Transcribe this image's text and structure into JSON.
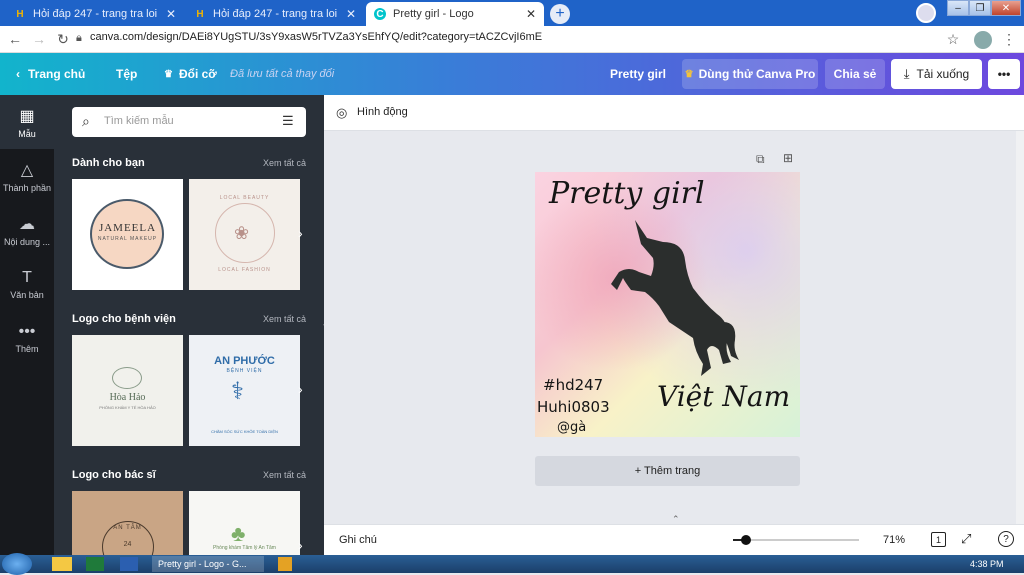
{
  "browser": {
    "tabs": [
      {
        "label": "Hỏi đáp 247 - trang tra loi",
        "favicon": "H",
        "close": "✕"
      },
      {
        "label": "Hỏi đáp 247 - trang tra loi",
        "favicon": "H",
        "close": "✕"
      },
      {
        "label": "Pretty girl - Logo",
        "favicon": "C",
        "close": "✕"
      }
    ],
    "new_tab": "+",
    "url": "canva.com/design/DAEi8YUgSTU/3sY9xasW5rTVZa3YsEhfYQ/edit?category=tACZCvjI6mE",
    "window_controls": [
      "–",
      "❐",
      "✕"
    ]
  },
  "header": {
    "home": "Trang chủ",
    "file": "Tệp",
    "resize": "Đổi cỡ",
    "saved_status": "Đã lưu tất cả thay đổi",
    "design_title": "Pretty girl",
    "try_pro": "Dùng thử Canva Pro",
    "share": "Chia sẻ",
    "download": "Tải xuống",
    "more": "•••"
  },
  "rail": [
    {
      "label": "Mẫu",
      "icon": "layout-icon"
    },
    {
      "label": "Thành phần",
      "icon": "shapes-icon"
    },
    {
      "label": "Nội dung ...",
      "icon": "upload-cloud-icon"
    },
    {
      "label": "Văn bản",
      "icon": "text-icon"
    },
    {
      "label": "Thêm",
      "icon": "more-dots-icon"
    }
  ],
  "panel": {
    "search_placeholder": "Tìm kiếm mẫu",
    "sections": [
      {
        "title": "Dành cho bạn",
        "see_all": "Xem tất cả"
      },
      {
        "title": "Logo cho bệnh viện",
        "see_all": "Xem tất cả"
      },
      {
        "title": "Logo cho bác sĩ",
        "see_all": "Xem tất cả"
      }
    ],
    "thumbs": {
      "jameela_title": "JAMEELA",
      "jameela_sub": "NATURAL MAKEUP",
      "local_beauty_top": "LOCAL BEAUTY",
      "local_beauty_bottom": "LOCAL FASHION",
      "hoa_hao_title": "Hòa Hảo",
      "hoa_hao_sub": "PHÒNG KHÁM Y TẾ HÒA HẢO",
      "an_phuoc_title": "AN PHƯỚC",
      "an_phuoc_sub": "BỆNH VIỆN",
      "an_phuoc_foot": "CHĂM SÓC SỨC KHỎE TOÀN DIỆN",
      "an_tam_title": "AN TÂM",
      "an_tam_num": "24",
      "phong_kham": "Phòng khám Tâm lý An Tâm"
    }
  },
  "canvas": {
    "animate": "Hình động",
    "design_text": {
      "title": "Pretty girl",
      "tag1": "#hd247",
      "tag2": "Huhi0803",
      "tag3": "@gà",
      "country": "Việt Nam"
    },
    "add_page": "+ Thêm trang"
  },
  "footer": {
    "notes": "Ghi chú",
    "zoom": "71%",
    "zoom_fraction": 0.71,
    "page_count": "1",
    "help": "?"
  },
  "taskbar": {
    "active_window": "Pretty girl - Logo - G...",
    "time": "4:38 PM"
  },
  "colors": {
    "tab_bar": "#1f63c8",
    "header_start": "#12b4cc",
    "header_end": "#6d48de",
    "sidebar": "#293039",
    "rail": "#17191d"
  }
}
